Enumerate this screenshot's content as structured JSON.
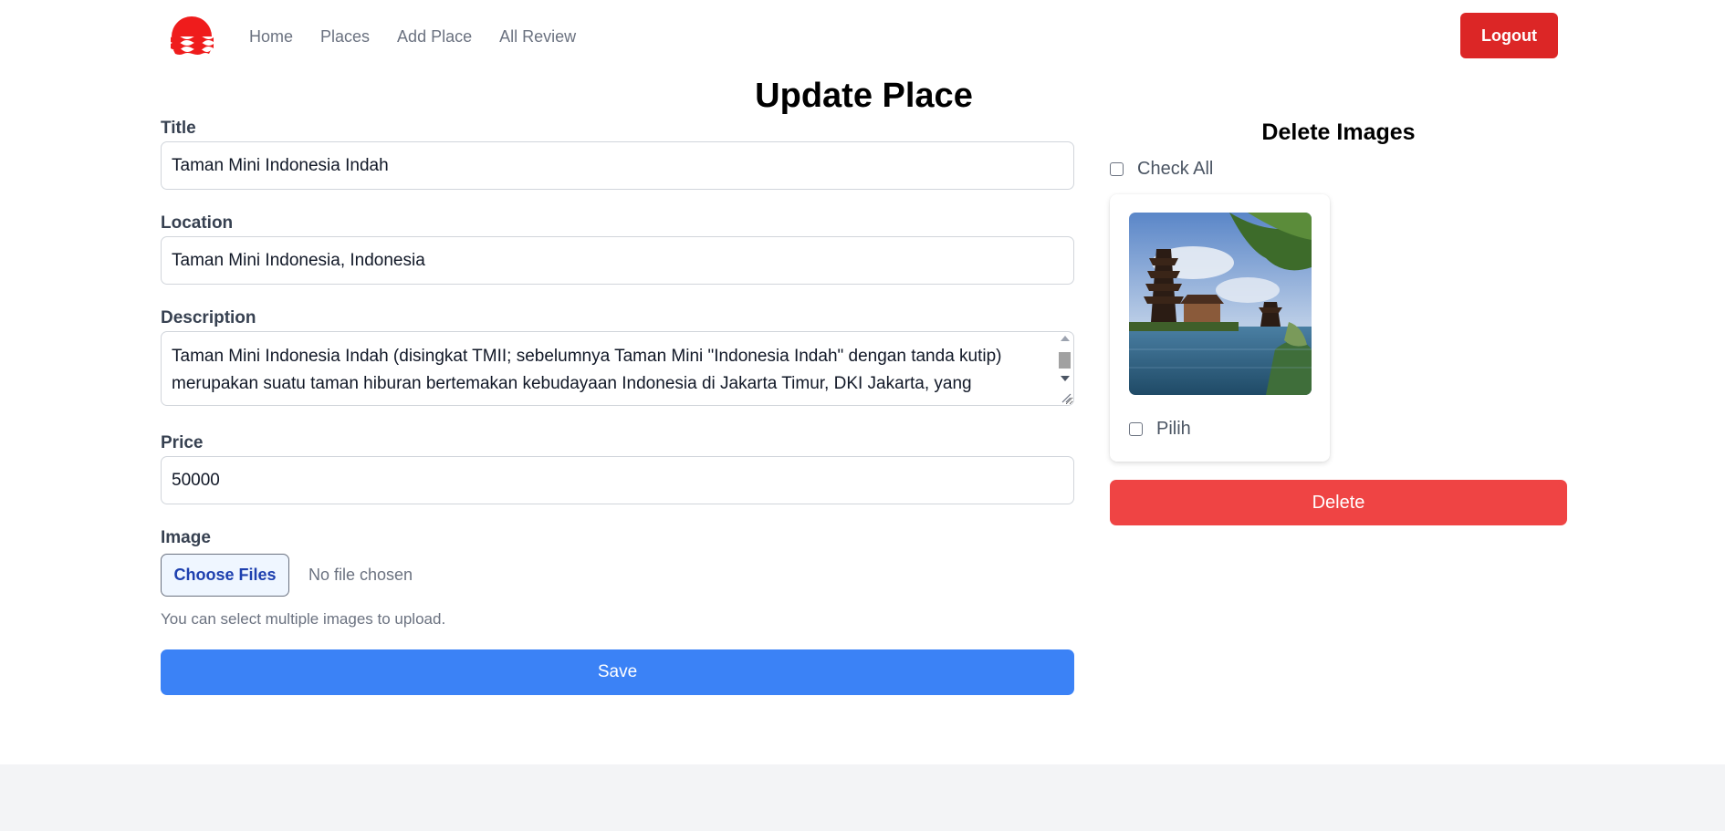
{
  "nav": {
    "logo_icon": "sun-waves-logo",
    "links": [
      "Home",
      "Places",
      "Add Place",
      "All Review"
    ],
    "logout_label": "Logout"
  },
  "page": {
    "title": "Update Place"
  },
  "form": {
    "title_label": "Title",
    "title_value": "Taman Mini Indonesia Indah",
    "location_label": "Location",
    "location_value": "Taman Mini Indonesia, Indonesia",
    "description_label": "Description",
    "description_line1": "Taman Mini Indonesia Indah (disingkat TMII; sebelumnya Taman Mini \"Indonesia Indah\" dengan tanda kutip)",
    "description_line2": "merupakan suatu taman hiburan bertemakan kebudayaan Indonesia di Jakarta Timur, DKI Jakarta, yang",
    "price_label": "Price",
    "price_value": "50000",
    "image_label": "Image",
    "choose_files_label": "Choose Files",
    "no_file_text": "No file chosen",
    "hint_text": "You can select multiple images to upload.",
    "save_label": "Save"
  },
  "delete_panel": {
    "title": "Delete Images",
    "check_all_label": "Check All",
    "image_checkbox_label": "Pilih",
    "delete_label": "Delete"
  },
  "colors": {
    "logout": "#dc2626",
    "save": "#3b82f6",
    "delete": "#ef4444",
    "logo": "#ef1c1c"
  }
}
